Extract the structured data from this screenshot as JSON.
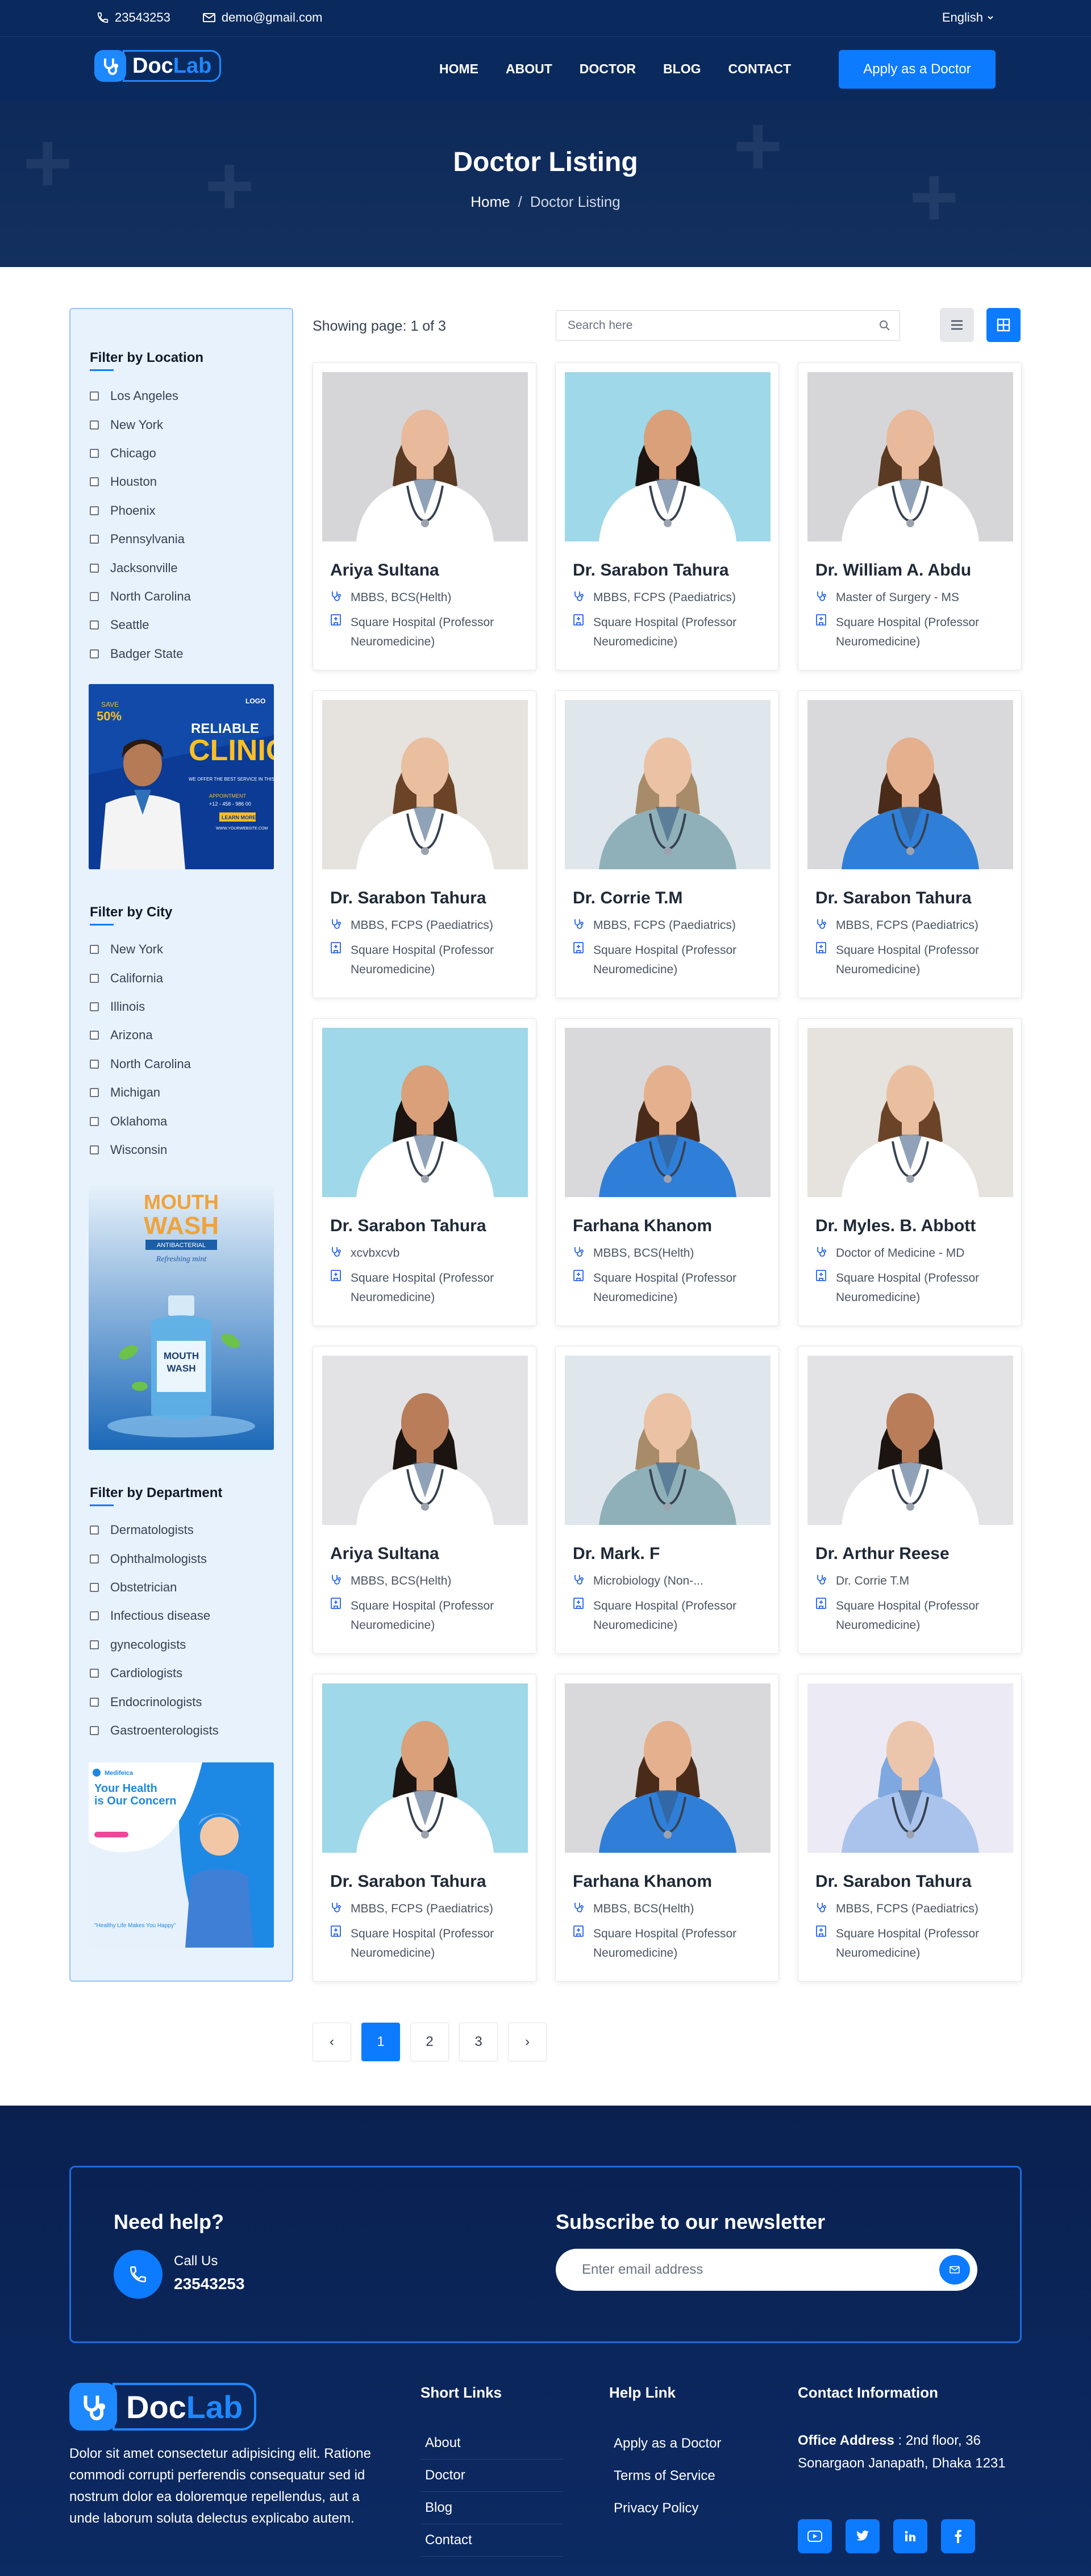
{
  "topbar": {
    "phone": "23543253",
    "email": "demo@gmail.com",
    "language": "English"
  },
  "brand": {
    "name_part1": "Doc",
    "name_part2": "Lab",
    "primary_color": "#0d7bff",
    "dark_navy": "#0a2a5e"
  },
  "nav": {
    "links": [
      "HOME",
      "ABOUT",
      "DOCTOR",
      "BLOG",
      "CONTACT"
    ],
    "cta": "Apply as a Doctor"
  },
  "hero": {
    "title": "Doctor Listing",
    "breadcrumb_home": "Home",
    "breadcrumb_separator": "/",
    "breadcrumb_current": "Doctor Listing"
  },
  "sidebar": {
    "location": {
      "title": "Filter by Location",
      "options": [
        "Los Angeles",
        "New York",
        "Chicago",
        "Houston",
        "Phoenix",
        "Pennsylvania",
        "Jacksonville",
        "North Carolina",
        "Seattle",
        "Badger State"
      ]
    },
    "city": {
      "title": "Filter by City",
      "options": [
        "New York",
        "California",
        "Illinois",
        "Arizona",
        "North Carolina",
        "Michigan",
        "Oklahoma",
        "Wisconsin"
      ]
    },
    "department": {
      "title": "Filter by Department",
      "options": [
        "Dermatologists",
        "Ophthalmologists",
        "Obstetrician",
        "Infectious disease",
        "gynecologists",
        "Cardiologists",
        "Endocrinologists",
        "Gastroenterologists"
      ]
    },
    "ad_clinic": {
      "save": "SAVE",
      "percent": "50%",
      "logo": "LOGO",
      "line1": "RELIABLE",
      "line2": "CLINIC",
      "offer": "WE OFFER THE BEST SERVICE IN THIS REGION",
      "appointment": "APPOINTMENT",
      "phone": "+12 - 458 - 986 00",
      "button": "LEARN MORE",
      "website": "WWW.YOURWEBSITE.COM"
    },
    "ad_mouthwash": {
      "line1": "MOUTH",
      "line2": "WASH",
      "sub": "ANTIBACTERIAL",
      "tagline": "Refreshing mint",
      "bottle_l1": "MOUTH",
      "bottle_l2": "WASH"
    },
    "ad_health": {
      "brand": "Medifeica",
      "line1": "Your Health",
      "line2": "is Our Concern",
      "note": "\"Healthy Life Makes You Happy\""
    }
  },
  "toolbar": {
    "showing": "Showing page: 1 of 3",
    "search_placeholder": "Search here"
  },
  "doctors": [
    {
      "name": "Ariya Sultana",
      "degree": "MBBS, BCS(Helth)",
      "hospital": "Square Hospital (Professor Neuromedicine)",
      "photo_bg": "#d6d6d8",
      "scrub": "#ffffff",
      "skin": "#e8b99a",
      "hair": "#5a3a22"
    },
    {
      "name": "Dr. Sarabon Tahura",
      "degree": "MBBS, FCPS (Paediatrics)",
      "hospital": "Square Hospital (Professor Neuromedicine)",
      "photo_bg": "#9fd8e8",
      "scrub": "#ffffff",
      "skin": "#d9a07a",
      "hair": "#1c1410"
    },
    {
      "name": "Dr. William A. Abdu",
      "degree": "Master of Surgery - MS",
      "hospital": "Square Hospital (Professor Neuromedicine)",
      "photo_bg": "#d6d6d8",
      "scrub": "#ffffff",
      "skin": "#e8b99a",
      "hair": "#5a3a22"
    },
    {
      "name": "Dr. Sarabon Tahura",
      "degree": "MBBS, FCPS (Paediatrics)",
      "hospital": "Square Hospital (Professor Neuromedicine)",
      "photo_bg": "#e6e2dd",
      "scrub": "#ffffff",
      "skin": "#e9bfa0",
      "hair": "#6b4327"
    },
    {
      "name": "Dr. Corrie T.M",
      "degree": "MBBS, FCPS (Paediatrics)",
      "hospital": "Square Hospital (Professor Neuromedicine)",
      "photo_bg": "#dfe7ec",
      "scrub": "#8fb0b8",
      "skin": "#ecc2a4",
      "hair": "#a88b68"
    },
    {
      "name": "Dr. Sarabon Tahura",
      "degree": "MBBS, FCPS (Paediatrics)",
      "hospital": "Square Hospital (Professor Neuromedicine)",
      "photo_bg": "#d9d9db",
      "scrub": "#2f7fd8",
      "skin": "#e4b08e",
      "hair": "#4a2b1a"
    },
    {
      "name": "Dr. Sarabon Tahura",
      "degree": "xcvbxcvb",
      "hospital": "Square Hospital (Professor Neuromedicine)",
      "photo_bg": "#9fd8e8",
      "scrub": "#ffffff",
      "skin": "#d9a07a",
      "hair": "#1c1410"
    },
    {
      "name": "Farhana Khanom",
      "degree": "MBBS, BCS(Helth)",
      "hospital": "Square Hospital (Professor Neuromedicine)",
      "photo_bg": "#d9d9db",
      "scrub": "#2f7fd8",
      "skin": "#e4b08e",
      "hair": "#4a2b1a"
    },
    {
      "name": "Dr. Myles. B. Abbott",
      "degree": "Doctor of Medicine - MD",
      "hospital": "Square Hospital (Professor Neuromedicine)",
      "photo_bg": "#e6e2dd",
      "scrub": "#ffffff",
      "skin": "#e9bfa0",
      "hair": "#6b4327"
    },
    {
      "name": "Ariya Sultana",
      "degree": "MBBS, BCS(Helth)",
      "hospital": "Square Hospital (Professor Neuromedicine)",
      "photo_bg": "#e3e3e5",
      "scrub": "#ffffff",
      "skin": "#b97d5a",
      "hair": "#1c1410"
    },
    {
      "name": "Dr. Mark. F",
      "degree": "Microbiology (Non-...",
      "hospital": "Square Hospital (Professor Neuromedicine)",
      "photo_bg": "#dfe7ec",
      "scrub": "#8fb0b8",
      "skin": "#ecc2a4",
      "hair": "#a88b68"
    },
    {
      "name": "Dr. Arthur Reese",
      "degree": "Dr. Corrie T.M",
      "hospital": "Square Hospital (Professor Neuromedicine)",
      "photo_bg": "#e3e3e5",
      "scrub": "#ffffff",
      "skin": "#b97d5a",
      "hair": "#1c1410"
    },
    {
      "name": "Dr. Sarabon Tahura",
      "degree": "MBBS, FCPS (Paediatrics)",
      "hospital": "Square Hospital (Professor Neuromedicine)",
      "photo_bg": "#9fd8e8",
      "scrub": "#ffffff",
      "skin": "#d9a07a",
      "hair": "#1c1410"
    },
    {
      "name": "Farhana Khanom",
      "degree": "MBBS, BCS(Helth)",
      "hospital": "Square Hospital (Professor Neuromedicine)",
      "photo_bg": "#d9d9db",
      "scrub": "#2f7fd8",
      "skin": "#e4b08e",
      "hair": "#4a2b1a"
    },
    {
      "name": "Dr. Sarabon Tahura",
      "degree": "MBBS, FCPS (Paediatrics)",
      "hospital": "Square Hospital (Professor Neuromedicine)",
      "photo_bg": "#eceaf4",
      "scrub": "#a9c3ec",
      "skin": "#ecc6ac",
      "hair": "#7fa8e0"
    }
  ],
  "pagination": {
    "prev": "‹",
    "pages": [
      "1",
      "2",
      "3"
    ],
    "current": "1",
    "next": "›"
  },
  "footer": {
    "help_title": "Need help?",
    "call_label": "Call Us",
    "call_number": "23543253",
    "newsletter_title": "Subscribe to our newsletter",
    "email_placeholder": "Enter email address",
    "description": "Dolor sit amet consectetur adipisicing elit. Ratione commodi corrupti perferendis consequatur sed id nostrum dolor ea doloremque repellendus, aut a unde laborum soluta delectus explicabo autem.",
    "short_links": {
      "title": "Short Links",
      "items": [
        "About",
        "Doctor",
        "Blog",
        "Contact"
      ]
    },
    "help_links": {
      "title": "Help Link",
      "items": [
        "Apply as a Doctor",
        "Terms of Service",
        "Privacy Policy"
      ]
    },
    "contact": {
      "title": "Contact Information",
      "address_label": "Office Address",
      "address": " : 2nd floor, 36 Sonargaon Janapath, Dhaka 1231"
    },
    "social": [
      "youtube-icon",
      "twitter-icon",
      "linkedin-icon",
      "facebook-icon"
    ]
  }
}
